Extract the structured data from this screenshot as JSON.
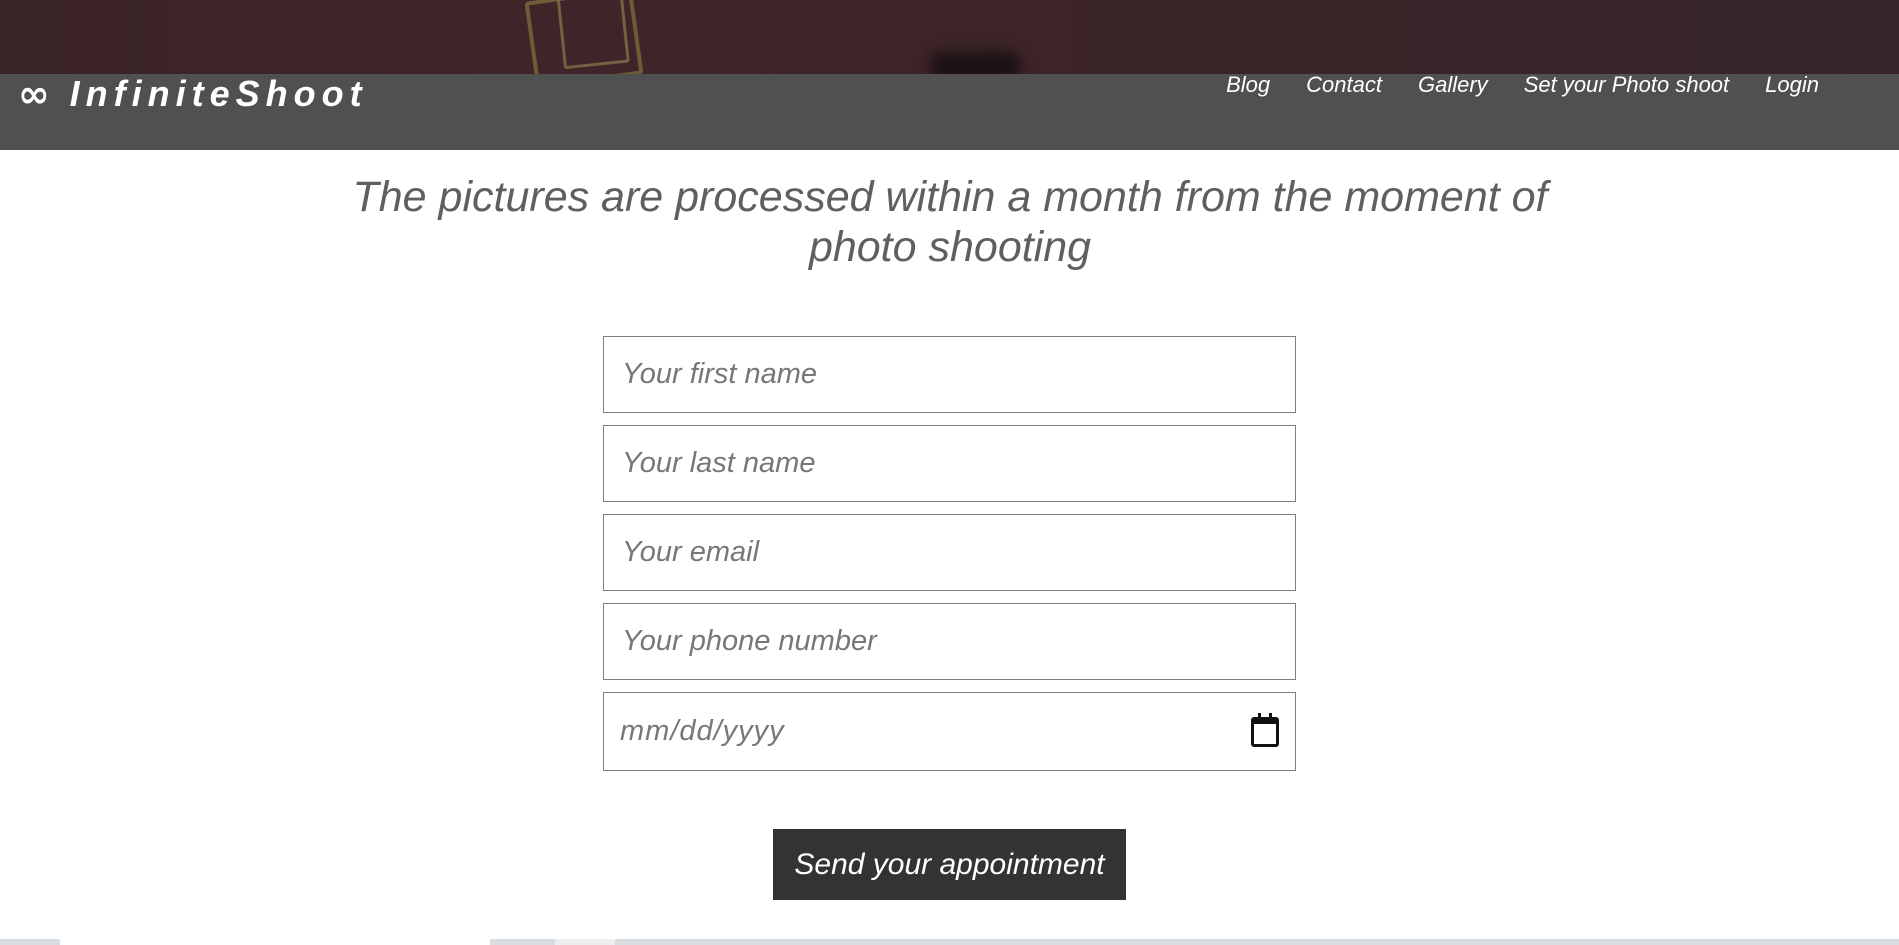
{
  "brand": {
    "icon": "infinity-icon",
    "icon_glyph": "∞",
    "name": "InfiniteShoot"
  },
  "nav": {
    "items": [
      "Blog",
      "Contact",
      "Gallery",
      "Set your Photo shoot",
      "Login"
    ]
  },
  "headline": "The pictures are processed within a month from the moment of photo shooting",
  "form": {
    "first_name_placeholder": "Your first name",
    "last_name_placeholder": "Your last name",
    "email_placeholder": "Your email",
    "phone_placeholder": "Your phone number",
    "date_placeholder": "mm/dd/yyyy",
    "date_icon": "calendar-icon",
    "submit_label": "Send your appointment"
  },
  "colors": {
    "navbar": "#505050",
    "hero": "#3b2428",
    "button": "#333333",
    "headline_text": "#5f5f5f",
    "placeholder_text": "#777777"
  }
}
